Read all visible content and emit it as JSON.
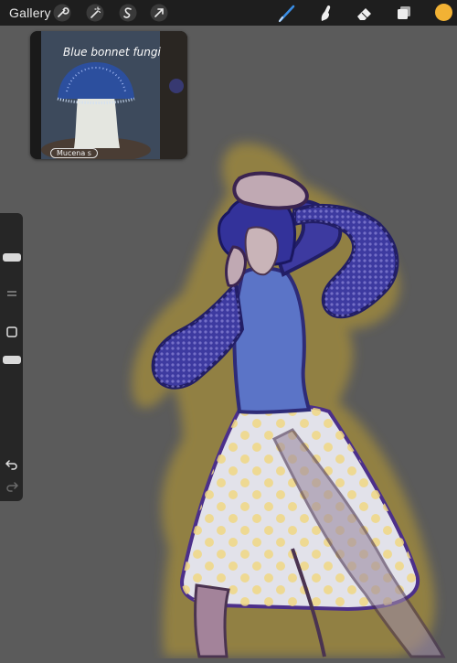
{
  "toolbar": {
    "gallery_label": "Gallery",
    "left_tools": [
      "wrench-icon",
      "magic-wand-icon",
      "selection-icon",
      "transform-arrow-icon"
    ],
    "right_tools": [
      "brush-icon",
      "smudge-icon",
      "eraser-icon",
      "layers-icon"
    ],
    "active_tool": "brush-icon",
    "active_color": "#f2b234",
    "brush_highlight_color": "#3a8ee6"
  },
  "reference": {
    "title": "Blue bonnet fungi",
    "caption": "Mucena s"
  },
  "sidebar": {
    "controls": [
      "brush-size-slider",
      "modify-button",
      "opacity-slider",
      "undo-icon",
      "redo-icon"
    ]
  }
}
